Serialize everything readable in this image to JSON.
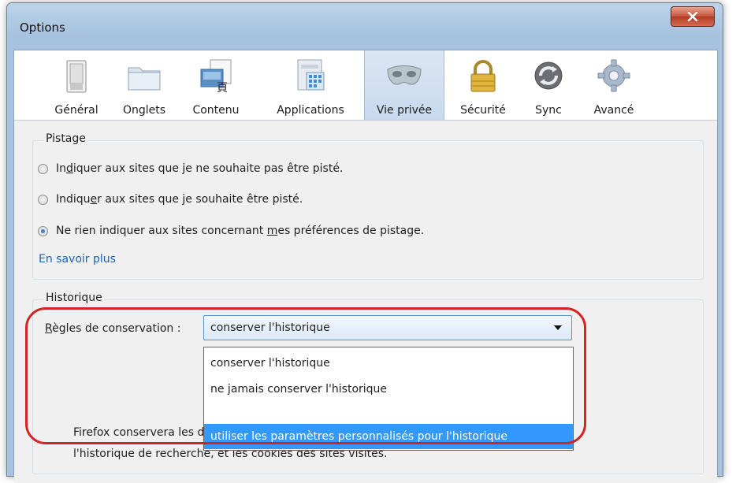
{
  "window": {
    "title": "Options"
  },
  "toolbar": {
    "items": [
      {
        "label": "Général",
        "icon": "general-switch-icon"
      },
      {
        "label": "Onglets",
        "icon": "tabs-folder-icon"
      },
      {
        "label": "Contenu",
        "icon": "content-page-icon"
      },
      {
        "label": "Applications",
        "icon": "applications-window-icon"
      },
      {
        "label": "Vie privée",
        "icon": "privacy-mask-icon",
        "selected": true
      },
      {
        "label": "Sécurité",
        "icon": "padlock-icon"
      },
      {
        "label": "Sync",
        "icon": "sync-arrows-icon"
      },
      {
        "label": "Avancé",
        "icon": "gear-icon"
      }
    ]
  },
  "tracking": {
    "caption": "Pistage",
    "options": [
      {
        "pre": "In",
        "key": "d",
        "post": "iquer aux sites que je ne souhaite pas être pisté.",
        "checked": false
      },
      {
        "pre": "Indiqu",
        "key": "e",
        "post": "r aux sites que je souhaite être pisté.",
        "checked": false
      },
      {
        "pre": "Ne rien indiquer aux sites concernant ",
        "key": "m",
        "post": "es préférences de pistage.",
        "checked": true
      }
    ],
    "learn_more": "En savoir plus"
  },
  "history": {
    "caption": "Historique",
    "rules_label_key": "R",
    "rules_label_rest": "ègles de conservation :",
    "selected_value": "conserver l'historique",
    "options": [
      "conserver l'historique",
      "ne jamais conserver l'historique",
      "utiliser les paramètres personnalisés pour l'historique"
    ],
    "highlighted_index": 2,
    "description_line1": "Firefox conservera les données de navigation, les téléchargements, les formulaires et",
    "description_line2": "l'historique de recherche, et les cookies des sites visités."
  },
  "colors": {
    "selection_blue": "#3399ff",
    "annotation_red": "#d42323",
    "link_blue": "#1d64b5"
  }
}
